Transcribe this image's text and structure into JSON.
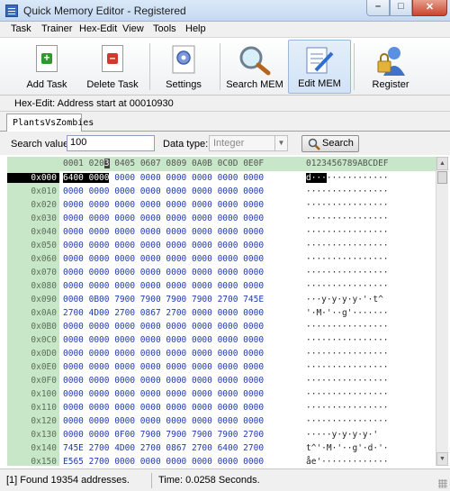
{
  "window": {
    "title": "Quick Memory Editor - Registered",
    "min_glyph": "–",
    "max_glyph": "□",
    "close_glyph": "✕"
  },
  "menu": [
    "Task",
    "Trainer",
    "Hex-Edit",
    "View",
    "Tools",
    "Help"
  ],
  "toolbar": {
    "add_task": "Add Task",
    "delete_task": "Delete Task",
    "settings": "Settings",
    "search_mem": "Search MEM",
    "edit_mem": "Edit MEM",
    "register": "Register",
    "add_glyph": "+",
    "delete_glyph": "–"
  },
  "hex_edit_status": "Hex-Edit: Address start at 00010930",
  "tab": "PlantsVsZombies",
  "search": {
    "value_label": "Search value:",
    "value": "100",
    "type_label": "Data type:",
    "type_value": "Integer",
    "button": "Search"
  },
  "grid": {
    "header_a": "0001 020",
    "header_cursor": "3",
    "header_b": " 0405 0607 0809 0A0B 0C0D 0E0F",
    "header_ascii": "0123456789ABCDEF",
    "addresses": [
      "0x000",
      "0x010",
      "0x020",
      "0x030",
      "0x040",
      "0x050",
      "0x060",
      "0x070",
      "0x080",
      "0x090",
      "0x0A0",
      "0x0B0",
      "0x0C0",
      "0x0D0",
      "0x0E0",
      "0x0F0",
      "0x100",
      "0x110",
      "0x120",
      "0x130",
      "0x140",
      "0x150"
    ],
    "row0_highlight": "6400 0000",
    "row0_rest": " 0000 0000 0000 0000 0000 0000",
    "row0_ascii_highlight": "d···",
    "row0_ascii_rest": "············",
    "rows": [
      "0000 0000 0000 0000 0000 0000 0000 0000",
      "0000 0000 0000 0000 0000 0000 0000 0000",
      "0000 0000 0000 0000 0000 0000 0000 0000",
      "0000 0000 0000 0000 0000 0000 0000 0000",
      "0000 0000 0000 0000 0000 0000 0000 0000",
      "0000 0000 0000 0000 0000 0000 0000 0000",
      "0000 0000 0000 0000 0000 0000 0000 0000",
      "0000 0000 0000 0000 0000 0000 0000 0000",
      "0000 0B00 7900 7900 7900 7900 2700 745E",
      "2700 4D00 2700 0867 2700 0000 0000 0000",
      "0000 0000 0000 0000 0000 0000 0000 0000",
      "0000 0000 0000 0000 0000 0000 0000 0000",
      "0000 0000 0000 0000 0000 0000 0000 0000",
      "0000 0000 0000 0000 0000 0000 0000 0000",
      "0000 0000 0000 0000 0000 0000 0000 0000",
      "0000 0000 0000 0000 0000 0000 0000 0000",
      "0000 0000 0000 0000 0000 0000 0000 0000",
      "0000 0000 0000 0000 0000 0000 0000 0000",
      "0000 0000 0F00 7900 7900 7900 7900 2700",
      "745E 2700 4D00 2700 0867 2700 6400 2700",
      "E565 2700 0000 0000 0000 0000 0000 0000"
    ],
    "ascii": [
      "················",
      "················",
      "················",
      "················",
      "················",
      "················",
      "················",
      "················",
      "···y·y·y·y·'·t^",
      "'·M·'··g'·······",
      "················",
      "················",
      "················",
      "················",
      "················",
      "················",
      "················",
      "················",
      "·····y·y·y·y·'",
      "t^'·M·'··g'·d·'·",
      "åe'·············"
    ]
  },
  "status": {
    "found": "[1] Found 19354 addresses.",
    "time": "Time:  0.0258 Seconds."
  },
  "colors": {
    "address_bg": "#c8e6c8",
    "hex_text": "#1f3bb0",
    "highlight": "#000000"
  }
}
